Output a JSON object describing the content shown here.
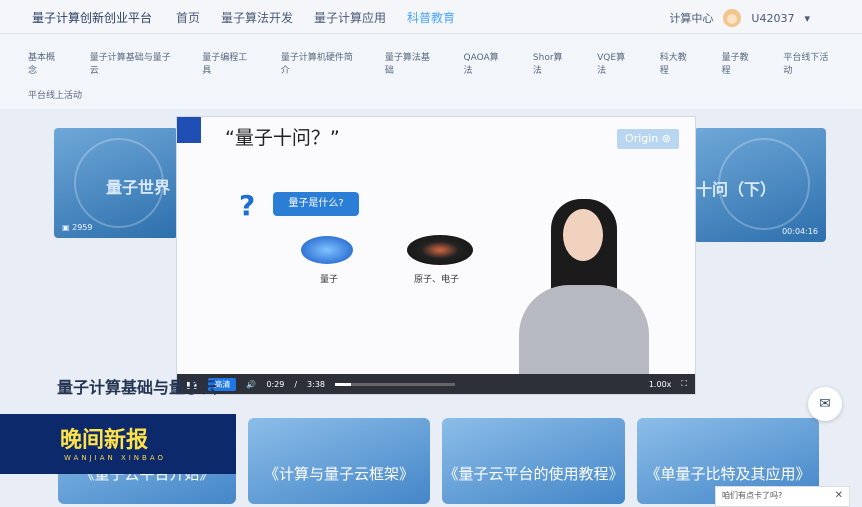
{
  "header": {
    "brand": "量子计算创新创业平台",
    "nav": [
      "首页",
      "量子算法开发",
      "量子计算应用",
      "科普教育"
    ],
    "active_nav": 3,
    "compute_center": "计算中心",
    "user": "U42037"
  },
  "subnav": {
    "items": [
      "基本概念",
      "量子计算基础与量子云",
      "量子编程工具",
      "量子计算机硬件简介",
      "量子算法基础",
      "QAOA算法",
      "Shor算法",
      "VQE算法",
      "科大教程",
      "量子教程",
      "平台线下活动"
    ],
    "row2": "平台线上活动"
  },
  "left_card": {
    "title": "量子世界",
    "views": "2959"
  },
  "right_card": {
    "title": "十问（下）",
    "duration": "00:04:16"
  },
  "video": {
    "title": "“量子十问？”",
    "origin": "Origin",
    "bubble": "量子是什么?",
    "label1": "量子",
    "label2": "原子、电子",
    "quality": "高清",
    "time_current": "0:29",
    "time_sep": "/",
    "time_total": "3:38",
    "speed": "1.00x",
    "progress_fraction": 0.13
  },
  "section_title": "量子计算基础与量子云",
  "bottom_cards": [
    "《量子云平台开始》",
    "《计算与量子云框架》",
    "《量子云平台的使用教程》",
    "《单量子比特及其应用》"
  ],
  "tv_logo": {
    "title": "晚间新报",
    "subtitle": "WANJIAN XINBAO"
  },
  "chat": {
    "text": "咱们有点卡了吗?",
    "close": "✕"
  },
  "colors": {
    "accent": "#4aa6ff",
    "video_bar": "#2d3038",
    "quality_btn": "#1e77e6"
  }
}
